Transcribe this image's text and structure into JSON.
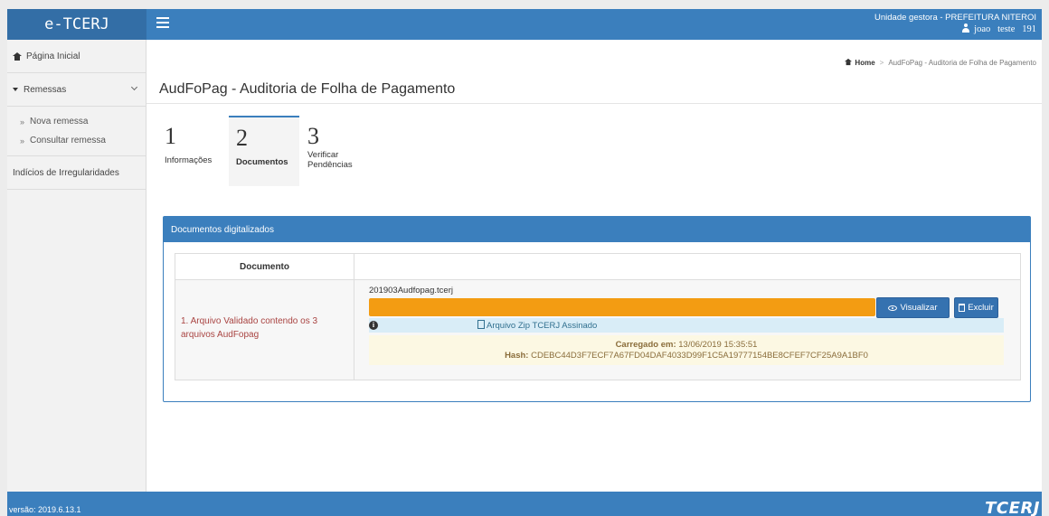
{
  "brand": "e-TCERJ",
  "header": {
    "unit": "Unidade gestora - PREFEITURA NITEROI",
    "user": "joao   teste   191"
  },
  "sidebar": {
    "home": "Página Inicial",
    "remessas": "Remessas",
    "sub": [
      "Nova remessa",
      "Consultar remessa"
    ],
    "indicios": "Indícios de Irregularidades",
    "bullet": "»"
  },
  "breadcrumb": {
    "home": "Home",
    "separator": ">",
    "current": "AudFoPag - Auditoria de Folha de Pagamento"
  },
  "page_title": "AudFoPag - Auditoria de Folha de Pagamento",
  "steps": [
    {
      "num": "1",
      "label": "Informações"
    },
    {
      "num": "2",
      "label": "Documentos"
    },
    {
      "num": "3",
      "label": "Verificar Pendências"
    }
  ],
  "panel": {
    "title": "Documentos digitalizados",
    "col_header": "Documento",
    "doc_label": "1. Arquivo Validado contendo os 3 arquivos AudFopag",
    "file_name": "201903Audfopag.tcerj",
    "btn_view": "Visualizar",
    "btn_delete": "Excluir",
    "zip_link": "Arquivo Zip TCERJ Assinado",
    "loaded_label": "Carregado em:",
    "loaded_value": "13/06/2019 15:35:51",
    "hash_label": "Hash:",
    "hash_value": "CDEBC44D3F7ECF7A67FD04DAF4033D99F1C5A19777154BE8CFEF7CF25A9A1BF0",
    "upload_progress_percent": 100
  },
  "footer": {
    "version": "versão: 2019.6.13.1",
    "logo": "TCERJ"
  },
  "colors": {
    "primary": "#3b7fbd",
    "progress": "#f39c12",
    "danger_text": "#a94442",
    "info_bg": "#d9edf7",
    "warning_bg": "#fcf8e3"
  }
}
